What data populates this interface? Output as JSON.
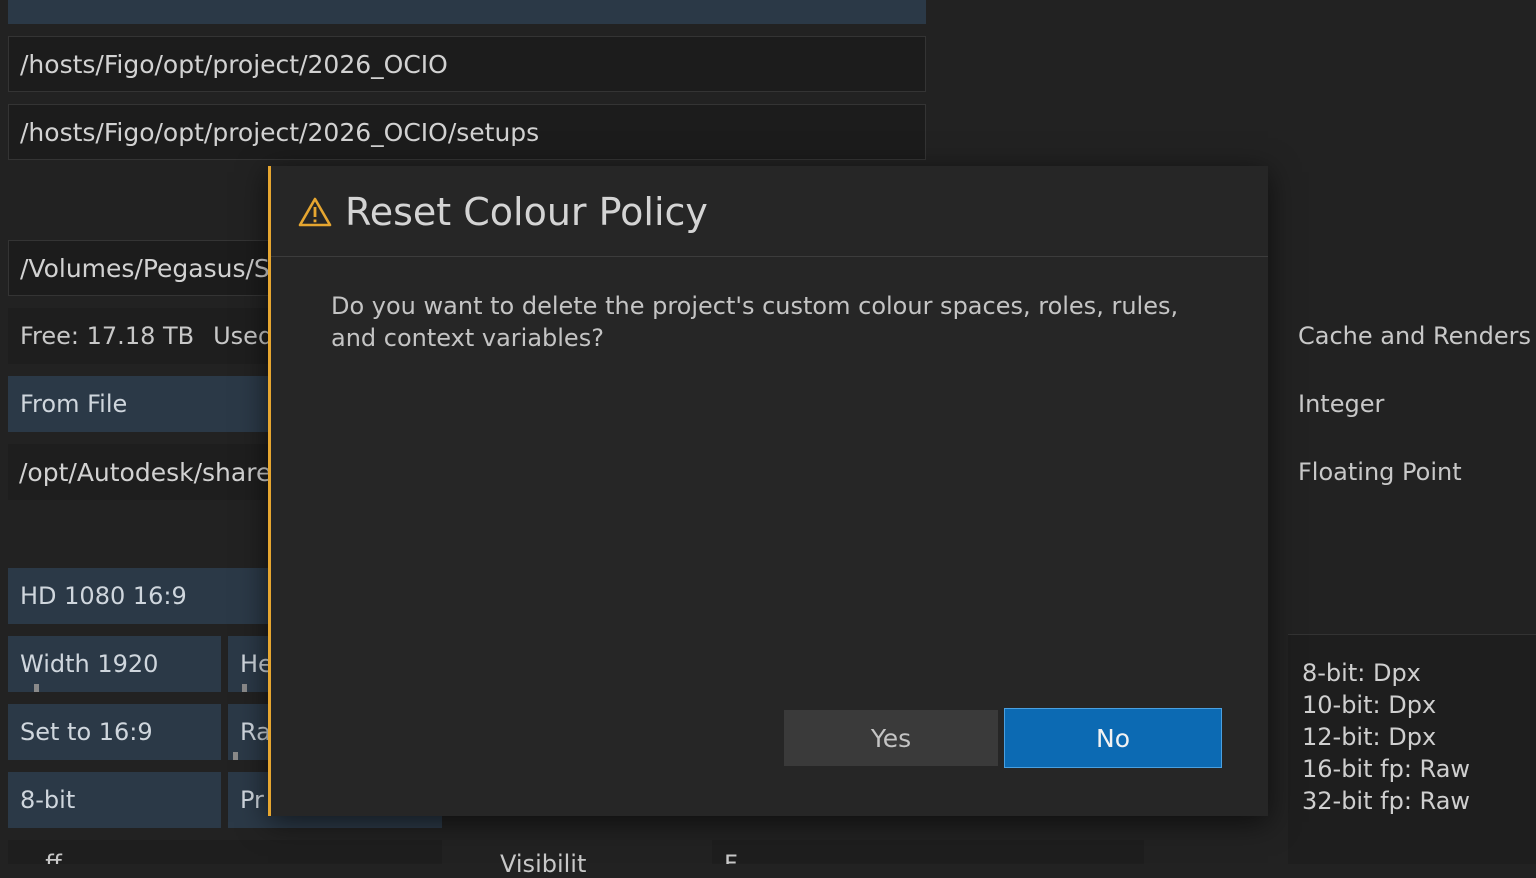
{
  "background": {
    "paths": {
      "project_path": "/hosts/Figo/opt/project/2026_OCIO",
      "setups_path": "/hosts/Figo/opt/project/2026_OCIO/setups",
      "media_path": "/Volumes/Pegasus/St",
      "ocio_path": "/opt/Autodesk/shared"
    },
    "storage": {
      "free": "Free: 17.18 TB",
      "used": "Used:"
    },
    "from_file_label": "From File",
    "resolution": {
      "preset": "HD 1080 16:9",
      "width": "Width 1920",
      "height_partial": "He",
      "set_ratio": "Set to 16:9",
      "ratio_partial": "Ra",
      "bit_depth": "8-bit",
      "pr_partial": "Pr"
    },
    "right_labels": {
      "cache": "Cache and Renders",
      "integer": "Integer",
      "floating": "Floating Point"
    },
    "formats": [
      "8-bit: Dpx",
      "10-bit: Dpx",
      "12-bit: Dpx",
      "16-bit fp: Raw",
      "32-bit fp: Raw"
    ],
    "bottom_partial": {
      "left": "..ff",
      "middle": "Visibilit",
      "right": "F"
    }
  },
  "dialog": {
    "title": "Reset Colour Policy",
    "icon": "warning-icon",
    "message": "Do you want to delete the project's custom colour spaces, roles, rules, and context variables?",
    "yes_label": "Yes",
    "no_label": "No",
    "accent_color": "#e6a630",
    "primary_color": "#0c6ab3"
  }
}
